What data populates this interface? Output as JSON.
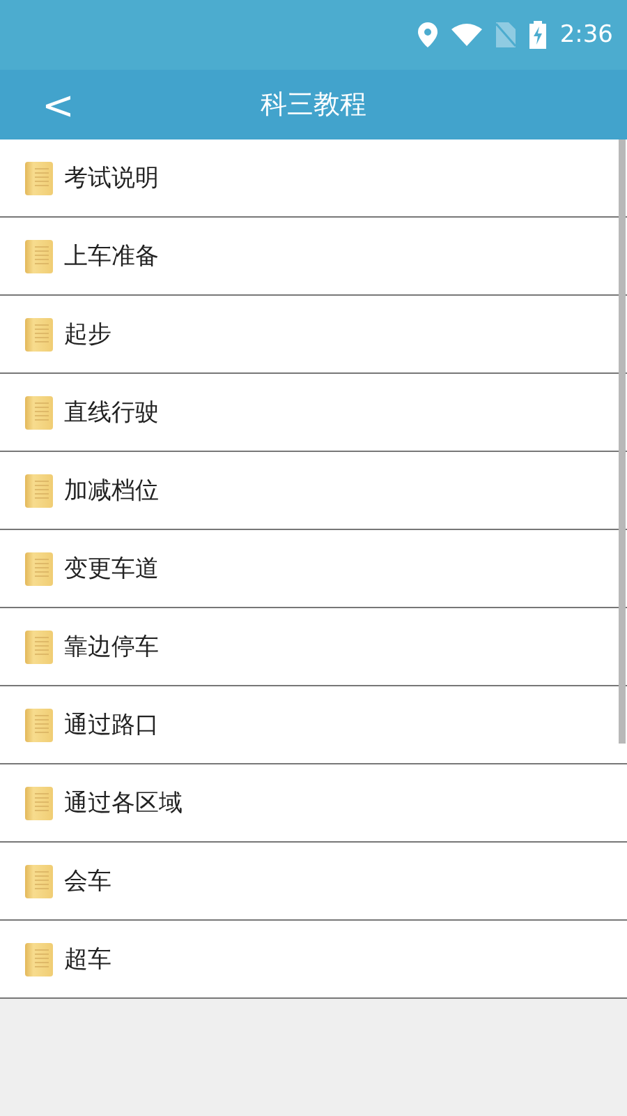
{
  "status_bar": {
    "time": "2:36"
  },
  "toolbar": {
    "back": "<",
    "title": "科三教程"
  },
  "items": [
    {
      "label": "考试说明"
    },
    {
      "label": "上车准备"
    },
    {
      "label": "起步"
    },
    {
      "label": "直线行驶"
    },
    {
      "label": "加减档位"
    },
    {
      "label": "变更车道"
    },
    {
      "label": "靠边停车"
    },
    {
      "label": "通过路口"
    },
    {
      "label": "通过各区域"
    },
    {
      "label": "会车"
    },
    {
      "label": "超车"
    }
  ]
}
